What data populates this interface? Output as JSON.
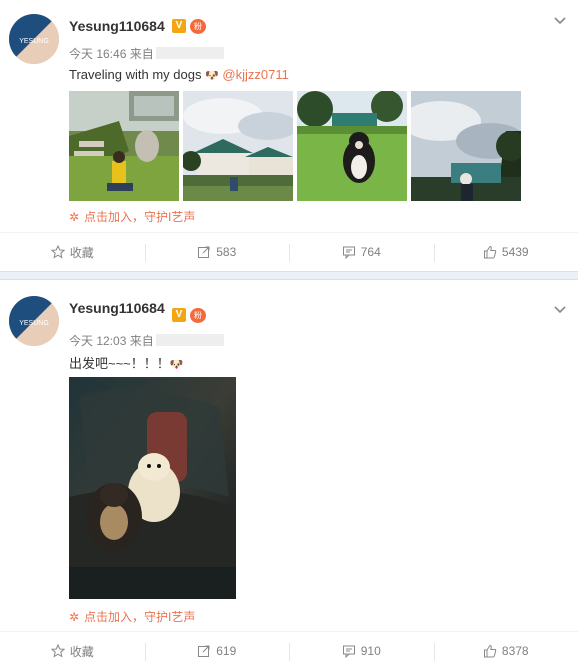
{
  "posts": [
    {
      "username": "Yesung110684",
      "avatar_text": "YESUNG",
      "time": "今天 16:46",
      "from": "来自",
      "text": "Traveling with my dogs ",
      "emoji": "🐶",
      "mention": "@kjjzz0711",
      "images": 4,
      "join_text": "点击加入，守护I艺声",
      "actions": {
        "favorite": "收藏",
        "repost": "583",
        "comment": "764",
        "like": "5439"
      }
    },
    {
      "username": "Yesung110684",
      "avatar_text": "YESUNG",
      "time": "今天 12:03",
      "from": "来自",
      "text": "出发吧~~~！！！",
      "emoji": "🐶",
      "join_text": "点击加入，守护I艺声",
      "actions": {
        "favorite": "收藏",
        "repost": "619",
        "comment": "910",
        "like": "8378"
      }
    }
  ],
  "badges": {
    "verified": "V",
    "medal": "粉"
  },
  "colors": {
    "accent": "#eb7350",
    "divider": "#eaf0f6",
    "muted": "#808080"
  }
}
